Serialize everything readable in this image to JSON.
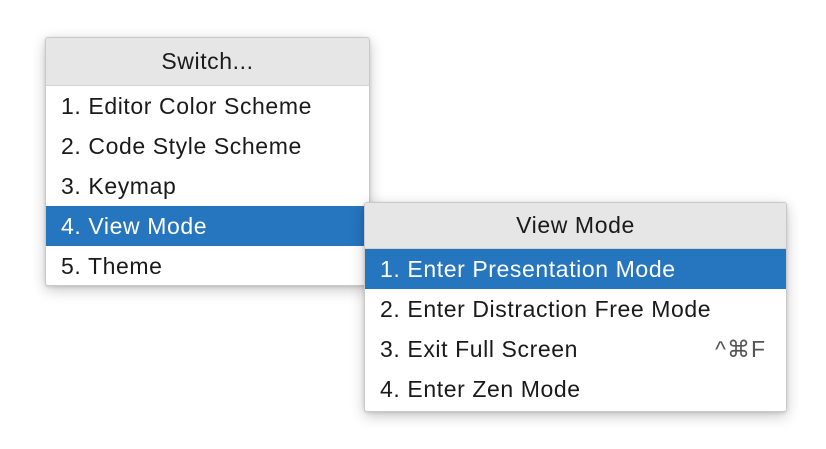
{
  "switch_popup": {
    "title": "Switch...",
    "items": [
      {
        "label": "1. Editor Color Scheme"
      },
      {
        "label": "2. Code Style Scheme"
      },
      {
        "label": "3. Keymap"
      },
      {
        "label": "4. View Mode",
        "selected": true
      },
      {
        "label": "5. Theme"
      }
    ]
  },
  "view_mode_popup": {
    "title": "View Mode",
    "items": [
      {
        "label": "1. Enter Presentation Mode",
        "selected": true,
        "shortcut": ""
      },
      {
        "label": "2. Enter Distraction Free Mode",
        "shortcut": ""
      },
      {
        "label": "3. Exit Full Screen",
        "shortcut": "^⌘F"
      },
      {
        "label": "4. Enter Zen Mode",
        "shortcut": ""
      }
    ]
  },
  "colors": {
    "selection": "#2675bf",
    "header_bg": "#e6e6e6"
  }
}
